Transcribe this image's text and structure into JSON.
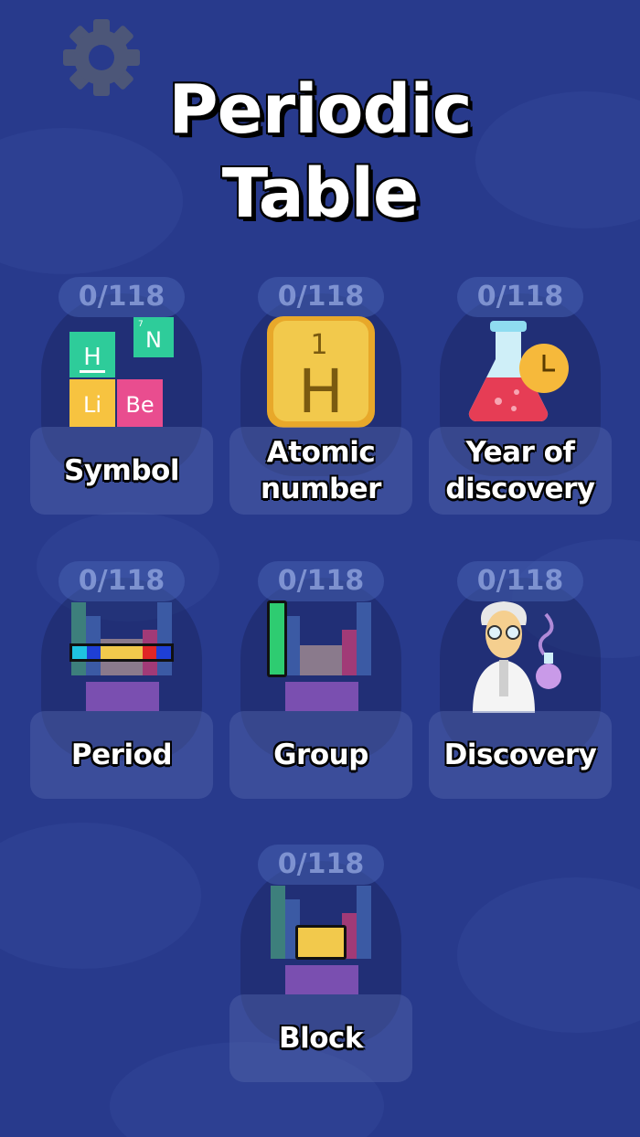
{
  "title_line1": "Periodic",
  "title_line2": "Table",
  "colors": {
    "background": "#283a8c",
    "text": "#ffffff"
  },
  "icons": {
    "settings": "gear-icon"
  },
  "modes": [
    {
      "counter": "0/118",
      "label": "Symbol",
      "icon": "element-tiles-icon"
    },
    {
      "counter": "0/118",
      "label": "Atomic number",
      "icon": "hydrogen-tile-icon"
    },
    {
      "counter": "0/118",
      "label": "Year of discovery",
      "icon": "flask-clock-icon"
    },
    {
      "counter": "0/118",
      "label": "Period",
      "icon": "period-row-icon"
    },
    {
      "counter": "0/118",
      "label": "Group",
      "icon": "group-column-icon"
    },
    {
      "counter": "0/118",
      "label": "Discovery",
      "icon": "scientist-icon"
    },
    {
      "counter": "0/118",
      "label": "Block",
      "icon": "block-icon"
    }
  ],
  "tiles": {
    "h": "H",
    "n": "N",
    "li": "Li",
    "be": "Be",
    "n_number": "7",
    "h_number": "1",
    "big_h": "H",
    "big_h_number": "1"
  }
}
